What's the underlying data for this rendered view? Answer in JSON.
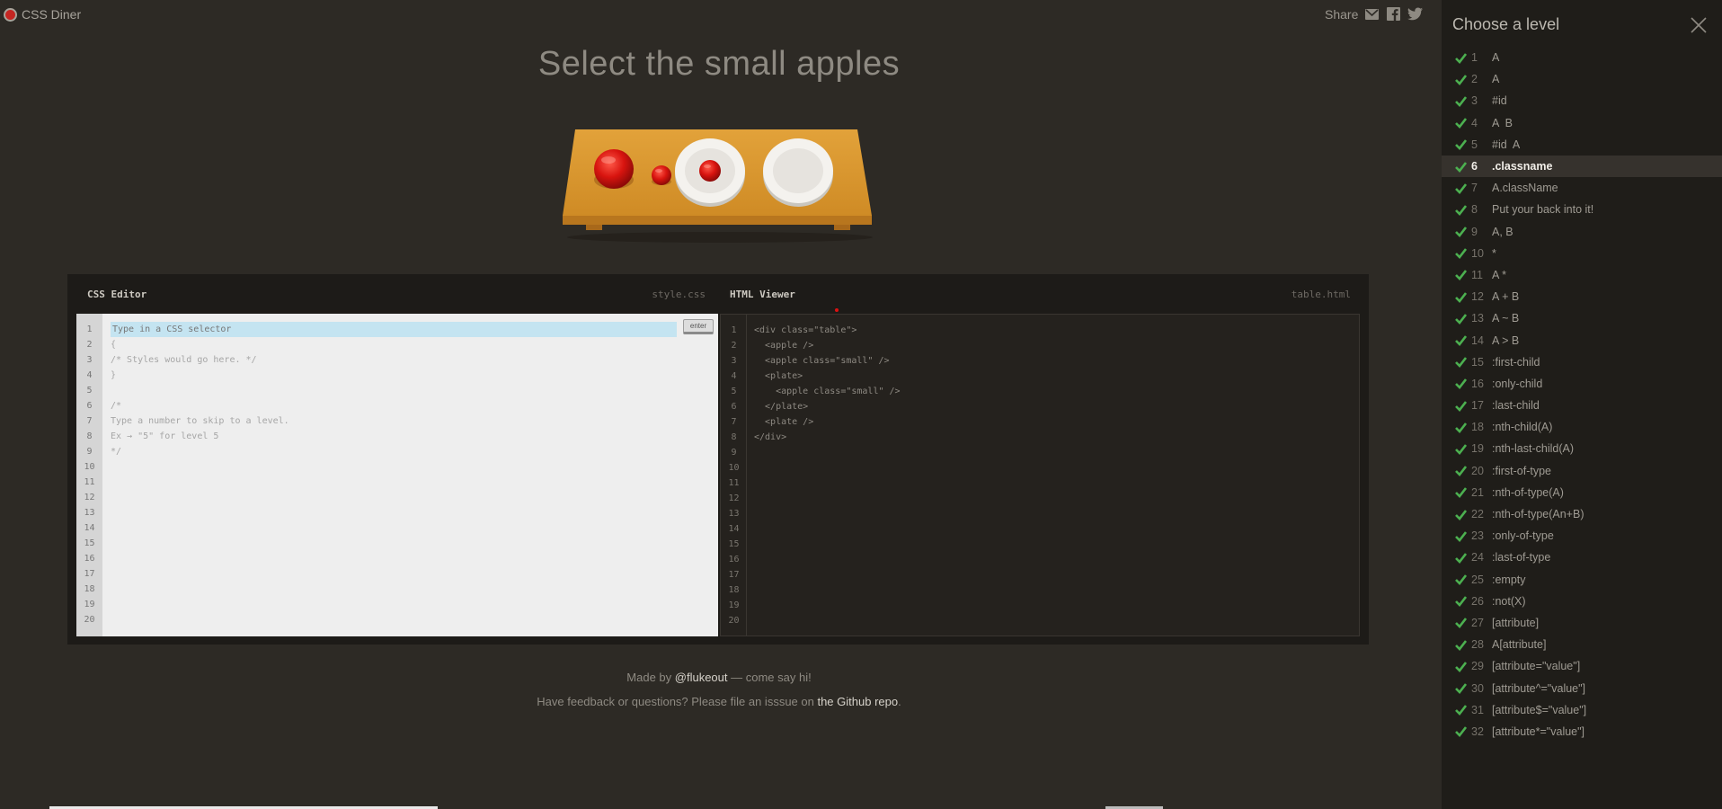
{
  "app": {
    "name": "CSS Diner"
  },
  "share": {
    "label": "Share",
    "icons": [
      "email-icon",
      "facebook-icon",
      "twitter-icon"
    ]
  },
  "instruction": "Select the small apples",
  "editor": {
    "css": {
      "title": "CSS Editor",
      "filename": "style.css",
      "input_placeholder": "Type in a CSS selector",
      "enter_label": "enter",
      "line_numbers": "1\n2\n3\n4\n5\n6\n7\n8\n9\n10\n11\n12\n13\n14\n15\n16\n17\n18\n19\n20",
      "code_rest": "{\n/* Styles would go here. */\n}\n\n/*\nType a number to skip to a level.\nEx → \"5\" for level 5\n*/"
    },
    "html": {
      "title": "HTML Viewer",
      "filename": "table.html",
      "line_numbers": "1\n2\n3\n4\n5\n6\n7\n8\n9\n10\n11\n12\n13\n14\n15\n16\n17\n18\n19\n20",
      "code": "<div class=\"table\">\n  <apple />\n  <apple class=\"small\" />\n  <plate>\n    <apple class=\"small\" />\n  </plate>\n  <plate />\n</div>"
    }
  },
  "footer": {
    "made_by_prefix": "Made by ",
    "made_by_link": "@flukeout",
    "made_by_suffix": " — come say hi!",
    "feedback_prefix": "Have feedback or questions? Please file an isssue on ",
    "feedback_link": "the Github repo",
    "feedback_suffix": "."
  },
  "levels_panel": {
    "title": "Choose a level",
    "current_level": 6,
    "check_color": "#4cb050",
    "levels": [
      {
        "num": "1",
        "name": "A"
      },
      {
        "num": "2",
        "name": "A"
      },
      {
        "num": "3",
        "name": "#id"
      },
      {
        "num": "4",
        "name": "A  B"
      },
      {
        "num": "5",
        "name": "#id  A"
      },
      {
        "num": "6",
        "name": ".classname"
      },
      {
        "num": "7",
        "name": "A.className"
      },
      {
        "num": "8",
        "name": "Put your back into it!"
      },
      {
        "num": "9",
        "name": "A, B"
      },
      {
        "num": "10",
        "name": "*"
      },
      {
        "num": "11",
        "name": "A *"
      },
      {
        "num": "12",
        "name": "A + B"
      },
      {
        "num": "13",
        "name": "A ~ B"
      },
      {
        "num": "14",
        "name": "A > B"
      },
      {
        "num": "15",
        "name": ":first-child"
      },
      {
        "num": "16",
        "name": ":only-child"
      },
      {
        "num": "17",
        "name": ":last-child"
      },
      {
        "num": "18",
        "name": ":nth-child(A)"
      },
      {
        "num": "19",
        "name": ":nth-last-child(A)"
      },
      {
        "num": "20",
        "name": ":first-of-type"
      },
      {
        "num": "21",
        "name": ":nth-of-type(A)"
      },
      {
        "num": "22",
        "name": ":nth-of-type(An+B)"
      },
      {
        "num": "23",
        "name": ":only-of-type"
      },
      {
        "num": "24",
        "name": ":last-of-type"
      },
      {
        "num": "25",
        "name": ":empty"
      },
      {
        "num": "26",
        "name": ":not(X)"
      },
      {
        "num": "27",
        "name": "[attribute]"
      },
      {
        "num": "28",
        "name": "A[attribute]"
      },
      {
        "num": "29",
        "name": "[attribute=\"value\"]"
      },
      {
        "num": "30",
        "name": "[attribute^=\"value\"]"
      },
      {
        "num": "31",
        "name": "[attribute$=\"value\"]"
      },
      {
        "num": "32",
        "name": "[attribute*=\"value\"]"
      }
    ]
  }
}
